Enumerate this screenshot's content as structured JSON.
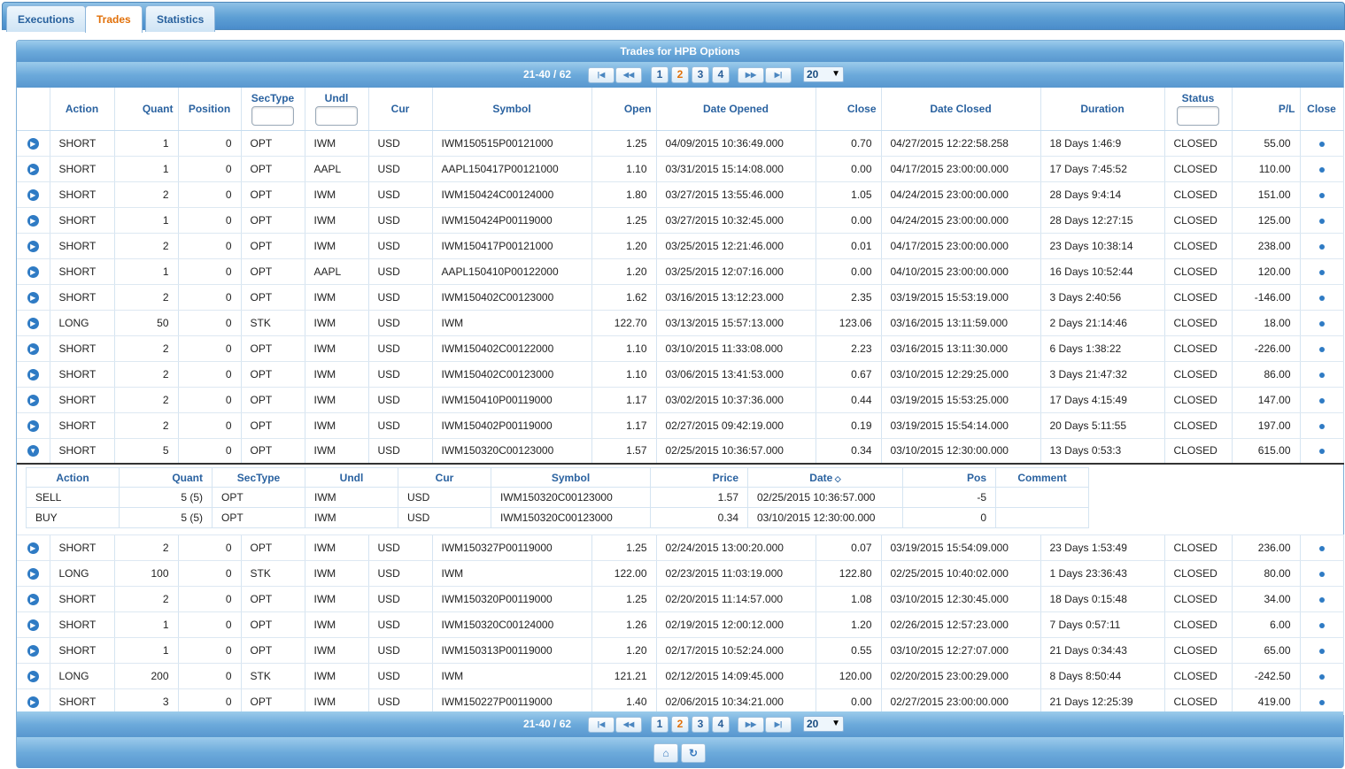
{
  "tabs": [
    "Executions",
    "Trades",
    "Statistics"
  ],
  "active_tab": "Trades",
  "grid": {
    "caption": "Trades for HPB Options",
    "record_info": "21-40 / 62",
    "pages": [
      "1",
      "2",
      "3",
      "4"
    ],
    "current_page": "2",
    "page_size": "20",
    "pager_icons": [
      "first-page-icon",
      "prev-page-icon",
      "next-page-icon",
      "last-page-icon"
    ],
    "footer_icons": [
      "home-icon",
      "refresh-icon"
    ]
  },
  "columns": {
    "action": "Action",
    "quant": "Quant",
    "position": "Position",
    "sectype": "SecType",
    "undl": "Undl",
    "cur": "Cur",
    "symbol": "Symbol",
    "open": "Open",
    "date_opened": "Date Opened",
    "close": "Close",
    "date_closed": "Date Closed",
    "duration": "Duration",
    "status": "Status",
    "pl": "P/L",
    "close_col": "Close"
  },
  "rows": [
    {
      "action": "SHORT",
      "quant": "1",
      "position": "0",
      "sectype": "OPT",
      "undl": "IWM",
      "cur": "USD",
      "symbol": "IWM150515P00121000",
      "open": "1.25",
      "date_opened": "04/09/2015 10:36:49.000",
      "close": "0.70",
      "date_closed": "04/27/2015 12:22:58.258",
      "duration": "18 Days 1:46:9",
      "status": "CLOSED",
      "pl": "55.00"
    },
    {
      "action": "SHORT",
      "quant": "1",
      "position": "0",
      "sectype": "OPT",
      "undl": "AAPL",
      "cur": "USD",
      "symbol": "AAPL150417P00121000",
      "open": "1.10",
      "date_opened": "03/31/2015 15:14:08.000",
      "close": "0.00",
      "date_closed": "04/17/2015 23:00:00.000",
      "duration": "17 Days 7:45:52",
      "status": "CLOSED",
      "pl": "110.00"
    },
    {
      "action": "SHORT",
      "quant": "2",
      "position": "0",
      "sectype": "OPT",
      "undl": "IWM",
      "cur": "USD",
      "symbol": "IWM150424C00124000",
      "open": "1.80",
      "date_opened": "03/27/2015 13:55:46.000",
      "close": "1.05",
      "date_closed": "04/24/2015 23:00:00.000",
      "duration": "28 Days 9:4:14",
      "status": "CLOSED",
      "pl": "151.00"
    },
    {
      "action": "SHORT",
      "quant": "1",
      "position": "0",
      "sectype": "OPT",
      "undl": "IWM",
      "cur": "USD",
      "symbol": "IWM150424P00119000",
      "open": "1.25",
      "date_opened": "03/27/2015 10:32:45.000",
      "close": "0.00",
      "date_closed": "04/24/2015 23:00:00.000",
      "duration": "28 Days 12:27:15",
      "status": "CLOSED",
      "pl": "125.00"
    },
    {
      "action": "SHORT",
      "quant": "2",
      "position": "0",
      "sectype": "OPT",
      "undl": "IWM",
      "cur": "USD",
      "symbol": "IWM150417P00121000",
      "open": "1.20",
      "date_opened": "03/25/2015 12:21:46.000",
      "close": "0.01",
      "date_closed": "04/17/2015 23:00:00.000",
      "duration": "23 Days 10:38:14",
      "status": "CLOSED",
      "pl": "238.00"
    },
    {
      "action": "SHORT",
      "quant": "1",
      "position": "0",
      "sectype": "OPT",
      "undl": "AAPL",
      "cur": "USD",
      "symbol": "AAPL150410P00122000",
      "open": "1.20",
      "date_opened": "03/25/2015 12:07:16.000",
      "close": "0.00",
      "date_closed": "04/10/2015 23:00:00.000",
      "duration": "16 Days 10:52:44",
      "status": "CLOSED",
      "pl": "120.00"
    },
    {
      "action": "SHORT",
      "quant": "2",
      "position": "0",
      "sectype": "OPT",
      "undl": "IWM",
      "cur": "USD",
      "symbol": "IWM150402C00123000",
      "open": "1.62",
      "date_opened": "03/16/2015 13:12:23.000",
      "close": "2.35",
      "date_closed": "03/19/2015 15:53:19.000",
      "duration": "3 Days 2:40:56",
      "status": "CLOSED",
      "pl": "-146.00"
    },
    {
      "action": "LONG",
      "quant": "50",
      "position": "0",
      "sectype": "STK",
      "undl": "IWM",
      "cur": "USD",
      "symbol": "IWM",
      "open": "122.70",
      "date_opened": "03/13/2015 15:57:13.000",
      "close": "123.06",
      "date_closed": "03/16/2015 13:11:59.000",
      "duration": "2 Days 21:14:46",
      "status": "CLOSED",
      "pl": "18.00"
    },
    {
      "action": "SHORT",
      "quant": "2",
      "position": "0",
      "sectype": "OPT",
      "undl": "IWM",
      "cur": "USD",
      "symbol": "IWM150402C00122000",
      "open": "1.10",
      "date_opened": "03/10/2015 11:33:08.000",
      "close": "2.23",
      "date_closed": "03/16/2015 13:11:30.000",
      "duration": "6 Days 1:38:22",
      "status": "CLOSED",
      "pl": "-226.00"
    },
    {
      "action": "SHORT",
      "quant": "2",
      "position": "0",
      "sectype": "OPT",
      "undl": "IWM",
      "cur": "USD",
      "symbol": "IWM150402C00123000",
      "open": "1.10",
      "date_opened": "03/06/2015 13:41:53.000",
      "close": "0.67",
      "date_closed": "03/10/2015 12:29:25.000",
      "duration": "3 Days 21:47:32",
      "status": "CLOSED",
      "pl": "86.00"
    },
    {
      "action": "SHORT",
      "quant": "2",
      "position": "0",
      "sectype": "OPT",
      "undl": "IWM",
      "cur": "USD",
      "symbol": "IWM150410P00119000",
      "open": "1.17",
      "date_opened": "03/02/2015 10:37:36.000",
      "close": "0.44",
      "date_closed": "03/19/2015 15:53:25.000",
      "duration": "17 Days 4:15:49",
      "status": "CLOSED",
      "pl": "147.00"
    },
    {
      "action": "SHORT",
      "quant": "2",
      "position": "0",
      "sectype": "OPT",
      "undl": "IWM",
      "cur": "USD",
      "symbol": "IWM150402P00119000",
      "open": "1.17",
      "date_opened": "02/27/2015 09:42:19.000",
      "close": "0.19",
      "date_closed": "03/19/2015 15:54:14.000",
      "duration": "20 Days 5:11:55",
      "status": "CLOSED",
      "pl": "197.00"
    },
    {
      "action": "SHORT",
      "quant": "5",
      "position": "0",
      "sectype": "OPT",
      "undl": "IWM",
      "cur": "USD",
      "symbol": "IWM150320C00123000",
      "open": "1.57",
      "date_opened": "02/25/2015 10:36:57.000",
      "close": "0.34",
      "date_closed": "03/10/2015 12:30:00.000",
      "duration": "13 Days 0:53:3",
      "status": "CLOSED",
      "pl": "615.00",
      "expanded": true
    },
    {
      "action": "SHORT",
      "quant": "2",
      "position": "0",
      "sectype": "OPT",
      "undl": "IWM",
      "cur": "USD",
      "symbol": "IWM150327P00119000",
      "open": "1.25",
      "date_opened": "02/24/2015 13:00:20.000",
      "close": "0.07",
      "date_closed": "03/19/2015 15:54:09.000",
      "duration": "23 Days 1:53:49",
      "status": "CLOSED",
      "pl": "236.00"
    },
    {
      "action": "LONG",
      "quant": "100",
      "position": "0",
      "sectype": "STK",
      "undl": "IWM",
      "cur": "USD",
      "symbol": "IWM",
      "open": "122.00",
      "date_opened": "02/23/2015 11:03:19.000",
      "close": "122.80",
      "date_closed": "02/25/2015 10:40:02.000",
      "duration": "1 Days 23:36:43",
      "status": "CLOSED",
      "pl": "80.00"
    },
    {
      "action": "SHORT",
      "quant": "2",
      "position": "0",
      "sectype": "OPT",
      "undl": "IWM",
      "cur": "USD",
      "symbol": "IWM150320P00119000",
      "open": "1.25",
      "date_opened": "02/20/2015 11:14:57.000",
      "close": "1.08",
      "date_closed": "03/10/2015 12:30:45.000",
      "duration": "18 Days 0:15:48",
      "status": "CLOSED",
      "pl": "34.00"
    },
    {
      "action": "SHORT",
      "quant": "1",
      "position": "0",
      "sectype": "OPT",
      "undl": "IWM",
      "cur": "USD",
      "symbol": "IWM150320C00124000",
      "open": "1.26",
      "date_opened": "02/19/2015 12:00:12.000",
      "close": "1.20",
      "date_closed": "02/26/2015 12:57:23.000",
      "duration": "7 Days 0:57:11",
      "status": "CLOSED",
      "pl": "6.00"
    },
    {
      "action": "SHORT",
      "quant": "1",
      "position": "0",
      "sectype": "OPT",
      "undl": "IWM",
      "cur": "USD",
      "symbol": "IWM150313P00119000",
      "open": "1.20",
      "date_opened": "02/17/2015 10:52:24.000",
      "close": "0.55",
      "date_closed": "03/10/2015 12:27:07.000",
      "duration": "21 Days 0:34:43",
      "status": "CLOSED",
      "pl": "65.00"
    },
    {
      "action": "LONG",
      "quant": "200",
      "position": "0",
      "sectype": "STK",
      "undl": "IWM",
      "cur": "USD",
      "symbol": "IWM",
      "open": "121.21",
      "date_opened": "02/12/2015 14:09:45.000",
      "close": "120.00",
      "date_closed": "02/20/2015 23:00:29.000",
      "duration": "8 Days 8:50:44",
      "status": "CLOSED",
      "pl": "-242.50"
    },
    {
      "action": "SHORT",
      "quant": "3",
      "position": "0",
      "sectype": "OPT",
      "undl": "IWM",
      "cur": "USD",
      "symbol": "IWM150227P00119000",
      "open": "1.40",
      "date_opened": "02/06/2015 10:34:21.000",
      "close": "0.00",
      "date_closed": "02/27/2015 23:00:00.000",
      "duration": "21 Days 12:25:39",
      "status": "CLOSED",
      "pl": "419.00"
    }
  ],
  "sub_grid": {
    "columns": {
      "action": "Action",
      "quant": "Quant",
      "sectype": "SecType",
      "undl": "Undl",
      "cur": "Cur",
      "symbol": "Symbol",
      "price": "Price",
      "date": "Date",
      "pos": "Pos",
      "comment": "Comment"
    },
    "rows": [
      {
        "action": "SELL",
        "quant": "5 (5)",
        "sectype": "OPT",
        "undl": "IWM",
        "cur": "USD",
        "symbol": "IWM150320C00123000",
        "price": "1.57",
        "date": "02/25/2015 10:36:57.000",
        "pos": "-5",
        "comment": ""
      },
      {
        "action": "BUY",
        "quant": "5 (5)",
        "sectype": "OPT",
        "undl": "IWM",
        "cur": "USD",
        "symbol": "IWM150320C00123000",
        "price": "0.34",
        "date": "03/10/2015 12:30:00.000",
        "pos": "0",
        "comment": ""
      }
    ]
  },
  "colors": {
    "positive": "#1e8a1e",
    "negative": "#e0201d",
    "header_text": "#2a62a0",
    "active_tab": "#e17009"
  }
}
